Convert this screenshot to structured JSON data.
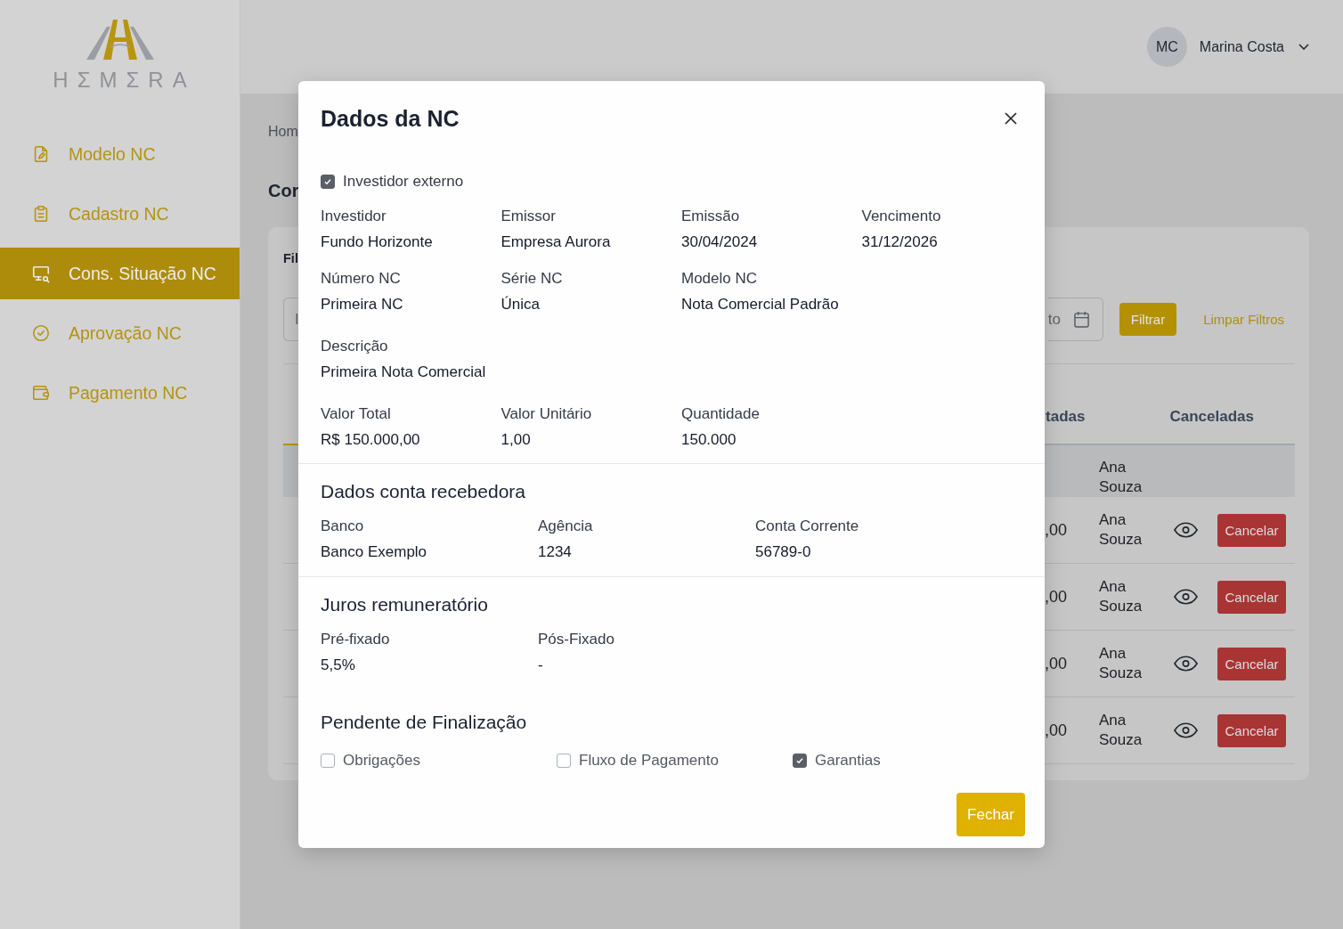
{
  "sidebar": {
    "logo": "HΣMΣRA",
    "items": [
      {
        "label": "Modelo NC",
        "selected": false
      },
      {
        "label": "Cadastro NC",
        "selected": false
      },
      {
        "label": "Cons. Situação NC",
        "selected": true
      },
      {
        "label": "Aprovação NC",
        "selected": false
      },
      {
        "label": "Pagamento NC",
        "selected": false
      }
    ]
  },
  "header": {
    "user": {
      "initials": "MC",
      "name": "Marina Costa"
    }
  },
  "page": {
    "breadcrumb": "Hom",
    "title": "Cor"
  },
  "card": {
    "title": "Fil",
    "filter_input": {
      "placeholder": "I"
    },
    "date_field": {
      "placeholder": "to"
    },
    "filter_button": "Filtrar",
    "clear_link": "Limpar Filtros",
    "tabs": [
      {
        "selected": true
      },
      {
        "label": "tadas",
        "selected": false
      },
      {
        "label": "Canceladas",
        "selected": false
      }
    ],
    "table": {
      "rows": [
        {
          "name": "Ana Souza",
          "selected": true
        },
        {
          "value": ",00",
          "name": "Ana Souza",
          "action": "Cancelar",
          "selected": false
        },
        {
          "value": ",00",
          "name": "Ana Souza",
          "action": "Cancelar",
          "selected": false
        },
        {
          "value": ",00",
          "name": "Ana Souza",
          "action": "Cancelar",
          "selected": false
        },
        {
          "value": ",00",
          "name": "Ana Souza",
          "action": "Cancelar",
          "selected": false
        }
      ]
    }
  },
  "modal": {
    "title": "Dados da NC",
    "external_investor": {
      "label": "Investidor externo",
      "checked": true
    },
    "field_rows": [
      {
        "fields": [
          {
            "label": "Investidor",
            "value": "Fundo Horizonte"
          },
          {
            "label": "Emissor",
            "value": "Empresa Aurora"
          },
          {
            "label": "Emissão",
            "value": "30/04/2024"
          },
          {
            "label": "Vencimento",
            "value": "31/12/2026"
          }
        ]
      },
      {
        "fields": [
          {
            "label": "Número NC",
            "value": "Primeira NC"
          },
          {
            "label": "Série NC",
            "value": "Única"
          },
          {
            "label": "Modelo NC",
            "value": "Nota Comercial Padrão"
          }
        ]
      },
      {
        "fields": [
          {
            "label": "Descrição",
            "value": "Primeira Nota Comercial"
          }
        ]
      },
      {
        "fields": [
          {
            "label": "Valor Total",
            "value": "R$ 150.000,00"
          },
          {
            "label": "Valor Unitário",
            "value": "1,00"
          },
          {
            "label": "Quantidade",
            "value": "150.000"
          }
        ]
      }
    ],
    "sections": [
      {
        "title": "Dados conta recebedora",
        "fields": [
          {
            "label": "Banco",
            "value": "Banco Exemplo"
          },
          {
            "label": "Agência",
            "value": "1234"
          },
          {
            "label": "Conta Corrente",
            "value": "56789-0"
          }
        ]
      },
      {
        "title": "Juros remuneratório",
        "fields": [
          {
            "label": "Pré-fixado",
            "value": "5,5%"
          },
          {
            "label": "Pós-Fixado",
            "value": "-"
          }
        ]
      }
    ],
    "pending": {
      "title": "Pendente de Finalização",
      "items": [
        {
          "label": "Obrigações",
          "checked": false
        },
        {
          "label": "Fluxo de Pagamento",
          "checked": false
        },
        {
          "label": "Garantias",
          "checked": true
        }
      ]
    },
    "close_button": "Fechar"
  }
}
